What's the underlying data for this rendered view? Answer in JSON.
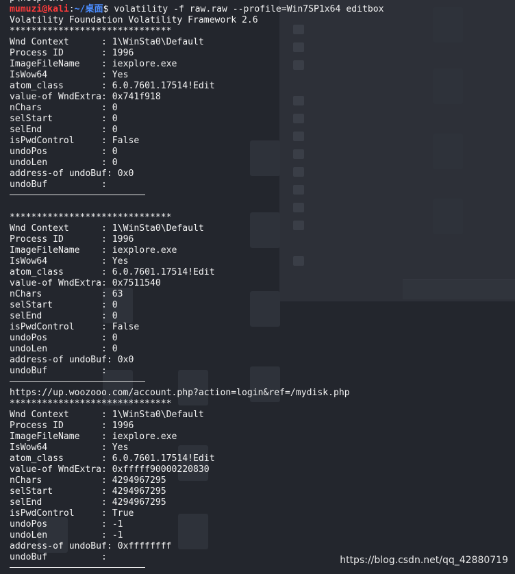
{
  "prev_line": "p\\help.txt",
  "prompt": {
    "user_host": "mumuzi@kali",
    "sep": ":",
    "path": "~/桌面",
    "symbol": "$",
    "command": " volatility -f raw.raw --profile=Win7SP1x64 editbox"
  },
  "banner": "Volatility Foundation Volatility Framework 2.6",
  "stars": "******************************",
  "records": [
    {
      "pre": "",
      "fields": [
        {
          "k": "Wnd Context      ",
          "v": "1\\WinSta0\\Default"
        },
        {
          "k": "Process ID       ",
          "v": "1996"
        },
        {
          "k": "ImageFileName    ",
          "v": "iexplore.exe"
        },
        {
          "k": "IsWow64          ",
          "v": "Yes"
        },
        {
          "k": "atom_class       ",
          "v": "6.0.7601.17514!Edit"
        },
        {
          "k": "value-of WndExtra",
          "v": "0x741f918"
        },
        {
          "k": "nChars           ",
          "v": "0"
        },
        {
          "k": "selStart         ",
          "v": "0"
        },
        {
          "k": "selEnd           ",
          "v": "0"
        },
        {
          "k": "isPwdControl     ",
          "v": "False"
        },
        {
          "k": "undoPos          ",
          "v": "0"
        },
        {
          "k": "undoLen          ",
          "v": "0"
        },
        {
          "k": "address-of undoBuf",
          "v": "0x0"
        },
        {
          "k": "undoBuf          ",
          "v": ""
        }
      ]
    },
    {
      "pre": "",
      "fields": [
        {
          "k": "Wnd Context      ",
          "v": "1\\WinSta0\\Default"
        },
        {
          "k": "Process ID       ",
          "v": "1996"
        },
        {
          "k": "ImageFileName    ",
          "v": "iexplore.exe"
        },
        {
          "k": "IsWow64          ",
          "v": "Yes"
        },
        {
          "k": "atom_class       ",
          "v": "6.0.7601.17514!Edit"
        },
        {
          "k": "value-of WndExtra",
          "v": "0x7511540"
        },
        {
          "k": "nChars           ",
          "v": "63"
        },
        {
          "k": "selStart         ",
          "v": "0"
        },
        {
          "k": "selEnd           ",
          "v": "0"
        },
        {
          "k": "isPwdControl     ",
          "v": "False"
        },
        {
          "k": "undoPos          ",
          "v": "0"
        },
        {
          "k": "undoLen          ",
          "v": "0"
        },
        {
          "k": "address-of undoBuf",
          "v": "0x0"
        },
        {
          "k": "undoBuf          ",
          "v": ""
        }
      ]
    },
    {
      "pre": "https://up.woozooo.com/account.php?action=login&ref=/mydisk.php",
      "fields": [
        {
          "k": "Wnd Context      ",
          "v": "1\\WinSta0\\Default"
        },
        {
          "k": "Process ID       ",
          "v": "1996"
        },
        {
          "k": "ImageFileName    ",
          "v": "iexplore.exe"
        },
        {
          "k": "IsWow64          ",
          "v": "Yes"
        },
        {
          "k": "atom_class       ",
          "v": "6.0.7601.17514!Edit"
        },
        {
          "k": "value-of WndExtra",
          "v": "0xfffff90000220830"
        },
        {
          "k": "nChars           ",
          "v": "4294967295"
        },
        {
          "k": "selStart         ",
          "v": "4294967295"
        },
        {
          "k": "selEnd           ",
          "v": "4294967295"
        },
        {
          "k": "isPwdControl     ",
          "v": "True"
        },
        {
          "k": "undoPos          ",
          "v": "-1"
        },
        {
          "k": "undoLen          ",
          "v": "-1"
        },
        {
          "k": "address-of undoBuf",
          "v": "0xffffffff"
        },
        {
          "k": "undoBuf          ",
          "v": ""
        }
      ]
    }
  ],
  "watermark": "https://blog.csdn.net/qq_42880719"
}
